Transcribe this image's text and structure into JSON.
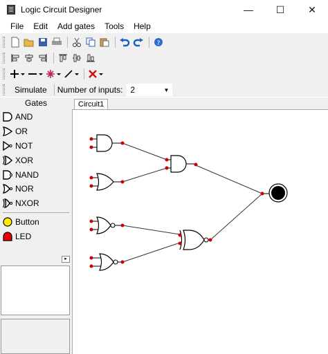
{
  "window": {
    "title": "Logic Circuit Designer",
    "minimize": "—",
    "maximize": "☐",
    "close": "✕"
  },
  "menu": [
    "File",
    "Edit",
    "Add gates",
    "Tools",
    "Help"
  ],
  "toolbar": {
    "row1_icons": [
      "new-document-icon",
      "open-folder-icon",
      "save-icon",
      "print-icon",
      "cut-icon",
      "copy-icon",
      "paste-icon",
      "undo-icon",
      "redo-icon",
      "help-icon"
    ],
    "row2_icons": [
      "align-left-icon",
      "align-center-icon",
      "align-right-icon",
      "align-top-icon",
      "align-middle-icon",
      "align-bottom-icon"
    ],
    "row3_icons": [
      "add-dropdown-icon",
      "remove-dropdown-icon",
      "burst-dropdown-icon",
      "wire-dropdown-icon",
      "delete-dropdown-icon"
    ]
  },
  "simulate": {
    "button": "Simulate",
    "inputs_label": "Number of inputs:",
    "inputs_value": "2"
  },
  "gates_panel": {
    "header": "Gates",
    "gates": [
      "AND",
      "OR",
      "NOT",
      "XOR",
      "NAND",
      "NOR",
      "NXOR"
    ],
    "io": [
      "Button",
      "LED"
    ],
    "colors": {
      "button": "#ffee00",
      "led": "#ee0000"
    }
  },
  "tabs": [
    "Circuit1"
  ],
  "circuit_colors": {
    "pin": "#cc0000",
    "wire": "#333333",
    "output": "#000000"
  }
}
